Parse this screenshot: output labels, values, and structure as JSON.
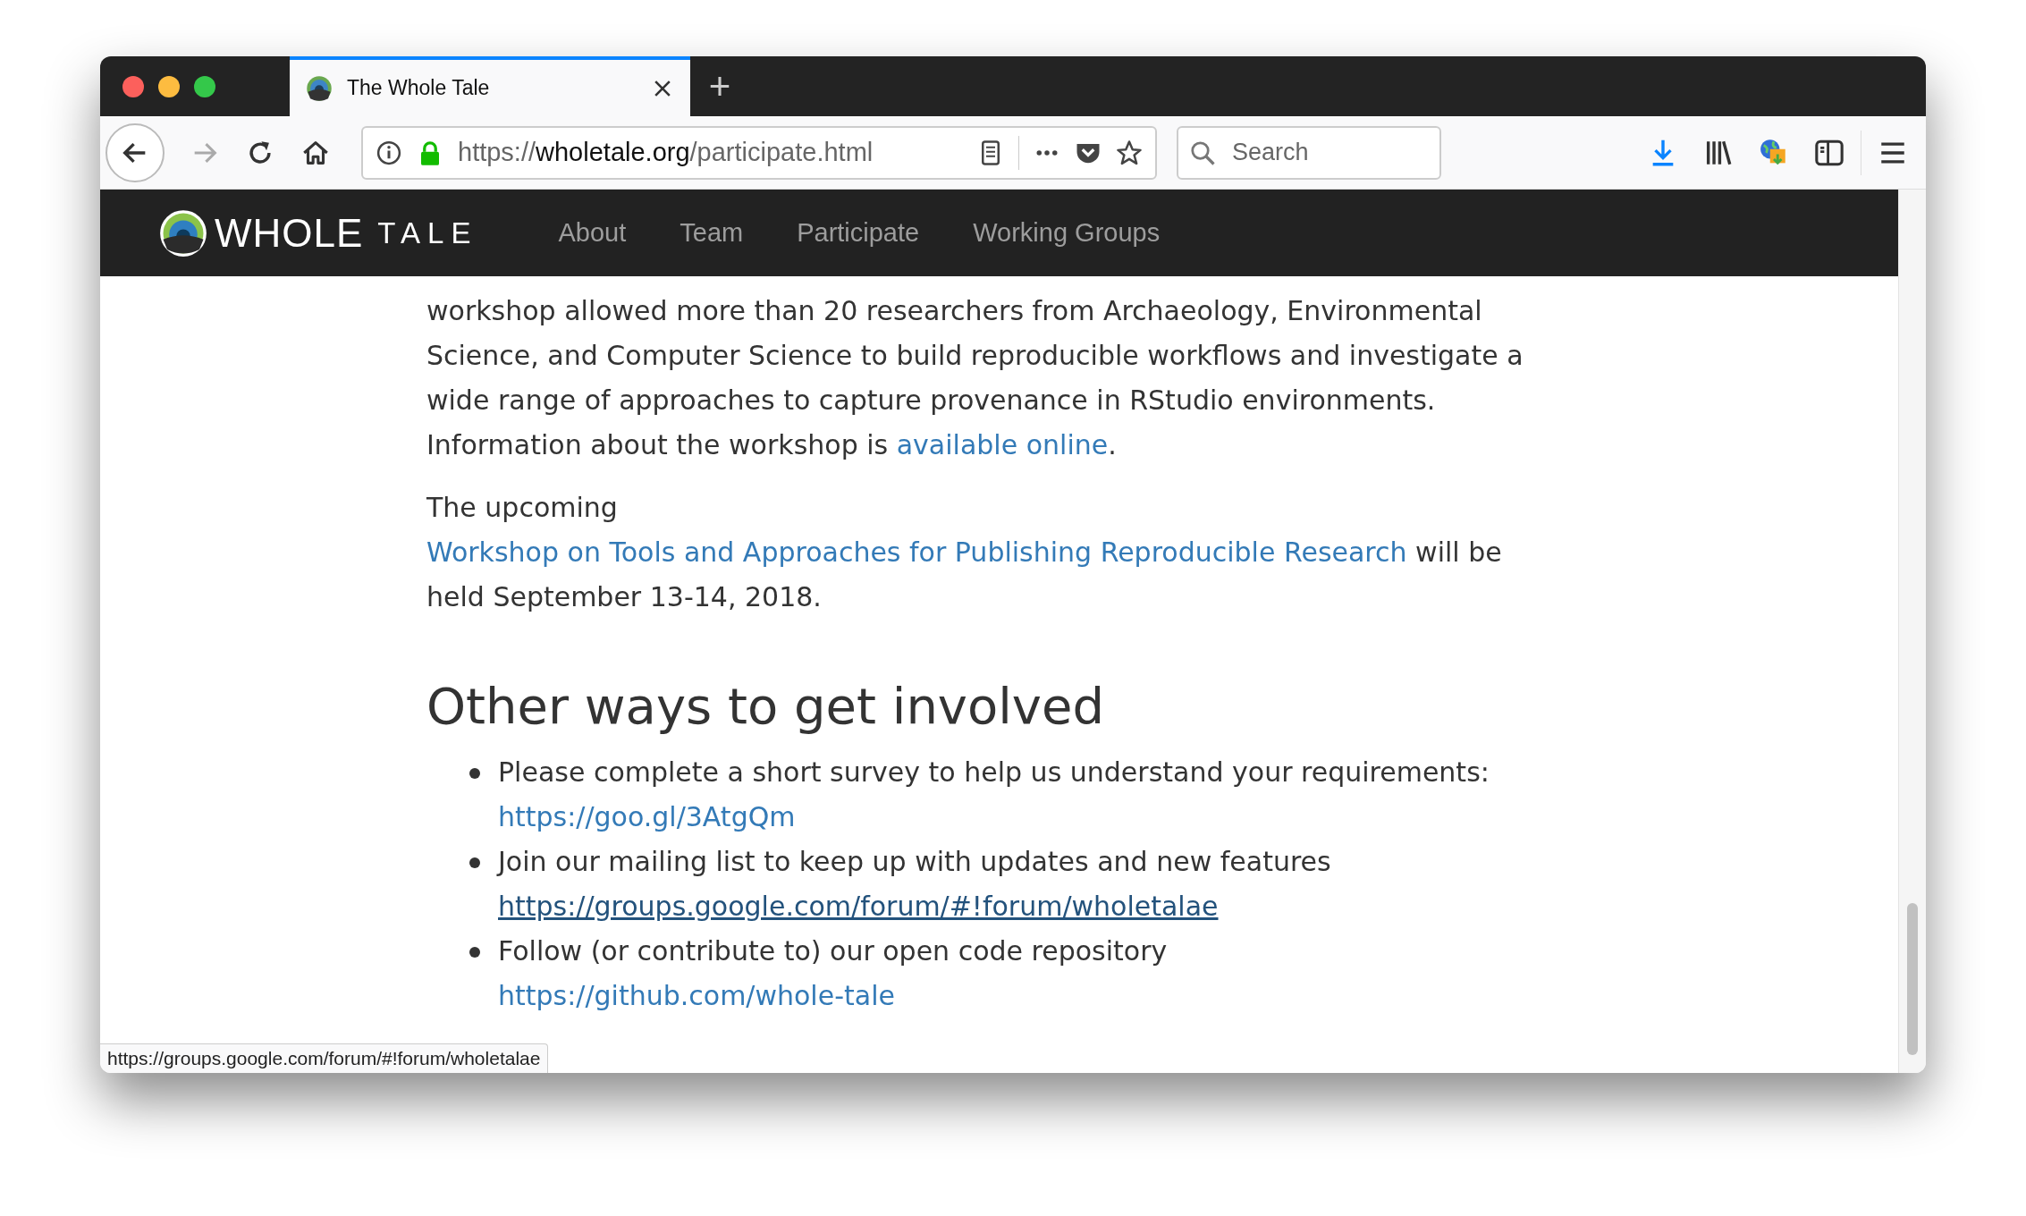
{
  "window": {
    "tabs": [
      {
        "title": "The Whole Tale",
        "selected": true
      }
    ],
    "new_tab": "+"
  },
  "toolbar": {
    "back_enabled": true,
    "forward_enabled": false,
    "url": {
      "scheme": "https://",
      "domain": "wholetale.org",
      "path": "/participate.html"
    },
    "search": {
      "placeholder": "Search"
    }
  },
  "site": {
    "logo": {
      "word_1": "WHOLE",
      "word_2": "TALE"
    },
    "nav": [
      {
        "label": "About"
      },
      {
        "label": "Team"
      },
      {
        "label": "Participate"
      },
      {
        "label": "Working Groups"
      }
    ]
  },
  "content": {
    "paragraphs": [
      {
        "segments": [
          {
            "kind": "text",
            "text": "workshop allowed more than 20 researchers from Archaeology, Environmental Science, and Computer Science to build reproducible workflows and investigate a wide range of approaches to capture provenance in RStudio environments. Information about the workshop is "
          },
          {
            "kind": "link",
            "text": "available online",
            "hovered": false
          },
          {
            "kind": "text",
            "text": "."
          }
        ]
      },
      {
        "segments": [
          {
            "kind": "text",
            "text": "The upcoming "
          },
          {
            "kind": "link",
            "text": "Workshop on Tools and Approaches for Publishing Reproducible Research",
            "hovered": false
          },
          {
            "kind": "text",
            "text": " will be held September 13-14, 2018."
          }
        ]
      }
    ],
    "heading": "Other ways to get involved",
    "bullets": [
      {
        "segments": [
          {
            "kind": "text",
            "text": "Please complete a short survey to help us understand your requirements: "
          },
          {
            "kind": "link",
            "text": "https://goo.gl/3AtgQm",
            "hovered": false
          }
        ]
      },
      {
        "segments": [
          {
            "kind": "text",
            "text": "Join our mailing list to keep up with updates and new features "
          },
          {
            "kind": "link",
            "text": "https://groups.google.com/forum/#!forum/wholetalae",
            "hovered": true
          }
        ]
      },
      {
        "segments": [
          {
            "kind": "text",
            "text": "Follow (or contribute to) our open code repository "
          },
          {
            "kind": "link",
            "text": "https://github.com/whole-tale",
            "hovered": false
          }
        ]
      }
    ]
  },
  "status_bar": "https://groups.google.com/forum/#!forum/wholetalae"
}
